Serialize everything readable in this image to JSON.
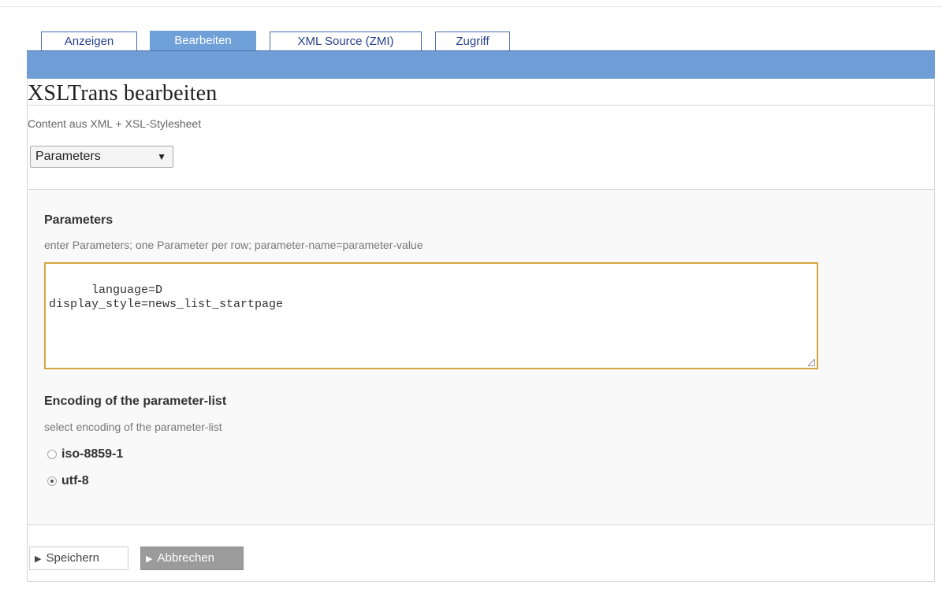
{
  "tabs": [
    {
      "label": "Anzeigen",
      "active": false
    },
    {
      "label": "Bearbeiten",
      "active": true
    },
    {
      "label": "XML Source (ZMI)",
      "active": false
    },
    {
      "label": "Zugriff",
      "active": false
    }
  ],
  "page": {
    "title": "XSLTrans bearbeiten",
    "description": "Content aus XML + XSL-Stylesheet",
    "view_select": "Parameters"
  },
  "parameters": {
    "label": "Parameters",
    "hint": "enter Parameters; one Parameter per row; parameter-name=parameter-value",
    "value": "language=D\ndisplay_style=news_list_startpage"
  },
  "encoding": {
    "label": "Encoding of the parameter-list",
    "hint": "select encoding of the parameter-list",
    "options": [
      {
        "label": "iso-8859-1",
        "checked": false
      },
      {
        "label": "utf-8",
        "checked": true
      }
    ]
  },
  "actions": {
    "save_label": "Speichern",
    "cancel_label": "Abbrechen"
  },
  "colors": {
    "tab_bar": "#6f9dd6",
    "textarea_focus_border": "#d4a640"
  }
}
